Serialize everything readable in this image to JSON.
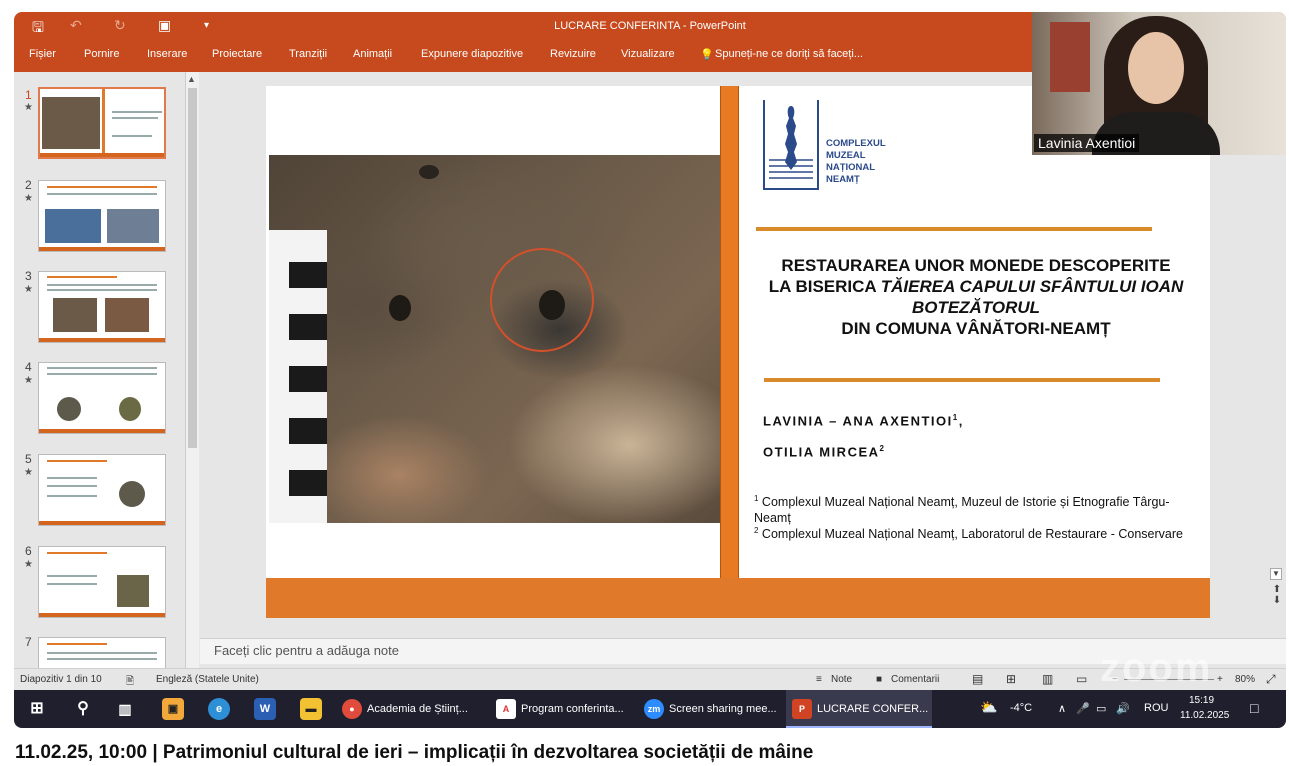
{
  "window": {
    "title": "LUCRARE  CONFERINTA - PowerPoint"
  },
  "colors": {
    "ribbon": "#c74a1e",
    "accent": "#e07a2a",
    "taskbar": "#1f1f2e"
  },
  "quick_access": {
    "save_icon": "save-icon",
    "undo_icon": "undo-icon",
    "redo_icon": "redo-icon",
    "present_icon": "present-icon"
  },
  "menu": [
    "Fișier",
    "Pornire",
    "Inserare",
    "Proiectare",
    "Tranziții",
    "Animații",
    "Expunere diapozitive",
    "Revizuire",
    "Vizualizare"
  ],
  "tell_me": "Spuneți-ne ce doriți să faceți...",
  "thumbnails": [
    {
      "num": "1",
      "star": "★"
    },
    {
      "num": "2",
      "star": "★"
    },
    {
      "num": "3",
      "star": "★"
    },
    {
      "num": "4",
      "star": "★"
    },
    {
      "num": "5",
      "star": "★"
    },
    {
      "num": "6",
      "star": "★"
    },
    {
      "num": "7",
      "star": ""
    }
  ],
  "slide": {
    "logo_text": [
      "COMPLEXUL",
      "MUZEAL",
      "NAȚIONAL",
      "NEAMȚ"
    ],
    "title_line1": "RESTAURAREA UNOR MONEDE DESCOPERITE",
    "title_line2_a": "LA BISERICA ",
    "title_line2_b": "TĂIEREA CAPULUI SFÂNTULUI IOAN",
    "title_line3": "BOTEZĂTORUL",
    "title_line4": "DIN COMUNA VÂNĂTORI-NEAMȚ",
    "author1": "LAVINIA – ANA AXENTIOI",
    "author1_sup": "1",
    "author1_tail": ",",
    "author2": "OTILIA MIRCEA",
    "author2_sup": "2",
    "affil1_sup": "1",
    "affil1": " Complexul Muzeal Național Neamț, Muzeul de Istorie și Etnografie Târgu-Neamț",
    "affil2_sup": "2",
    "affil2": " Complexul Muzeal Național Neamț, Laboratorul de Restaurare - Conservare"
  },
  "webcam": {
    "name": "Lavinia Axentioi"
  },
  "notes_placeholder": "Faceți clic pentru a adăuga note",
  "status": {
    "slide_of": "Diapozitiv 1 din 10",
    "language": "Engleză (Statele Unite)",
    "notes": "Note",
    "comments": "Comentarii",
    "zoom": "80%",
    "watermark": "zoom"
  },
  "taskbar": {
    "apps": [
      {
        "label": "Academia de Științ...",
        "icon": "chrome-icon"
      },
      {
        "label": "Program conferinta...",
        "icon": "pdf-icon"
      },
      {
        "label": "Screen sharing mee...",
        "icon": "zoom-icon"
      },
      {
        "label": "LUCRARE  CONFER...",
        "icon": "powerpoint-icon"
      }
    ],
    "weather": "-4°C",
    "lang": "ROU",
    "time": "15:19",
    "date": "11.02.2025"
  },
  "caption": "11.02.25, 10:00 | Patrimoniul cultural de ieri – implicații în dezvoltarea societății de mâine"
}
